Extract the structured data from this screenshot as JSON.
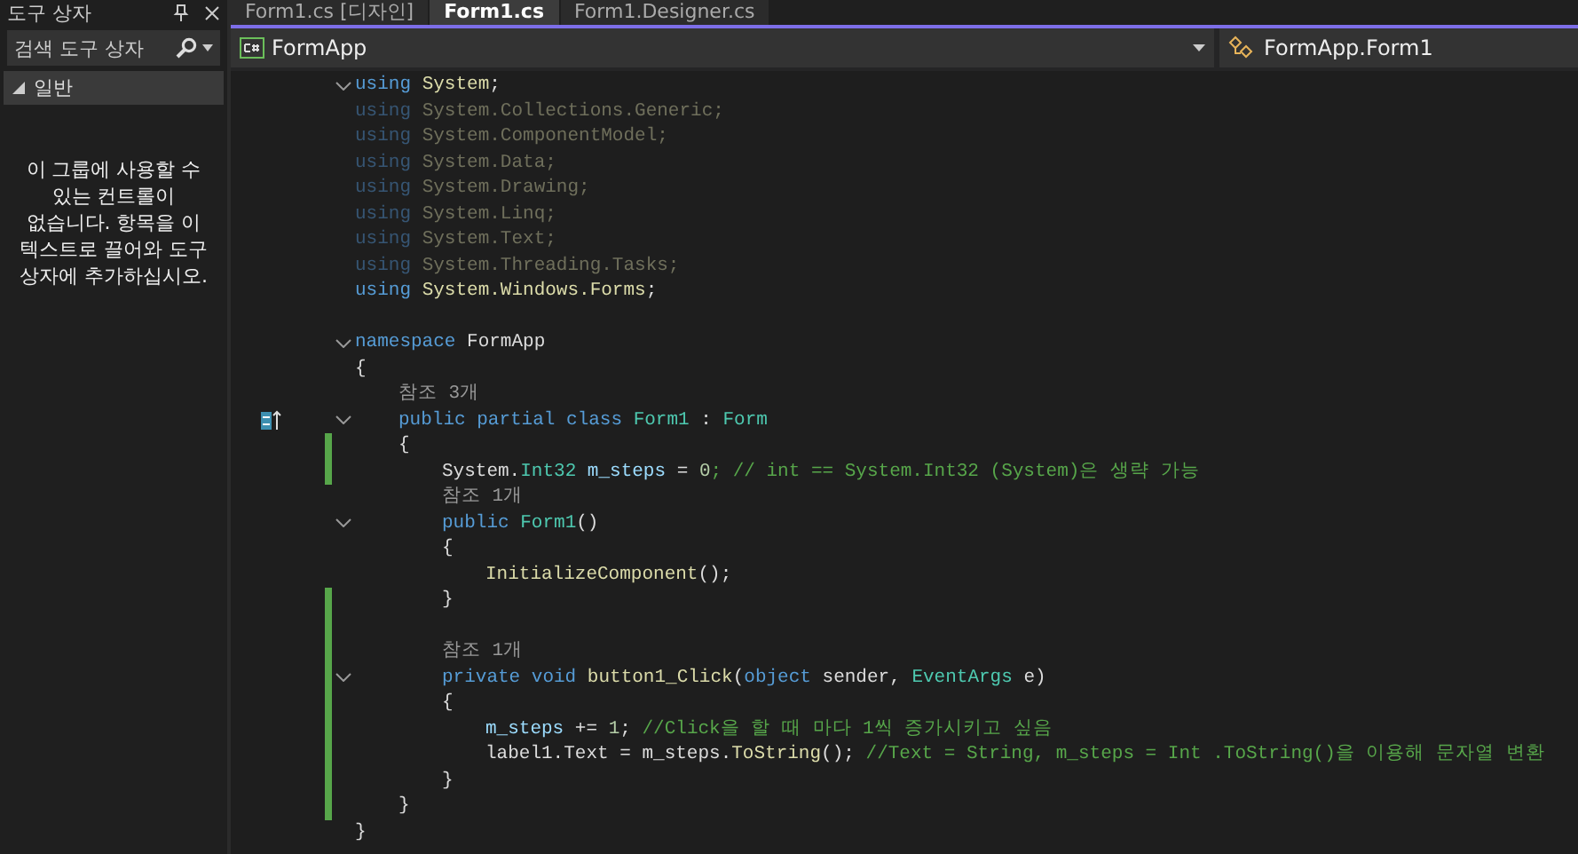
{
  "toolbox": {
    "title": "도구 상자",
    "search": {
      "placeholder": "검색 도구 상자"
    },
    "group": {
      "label": "일반",
      "expanded": true
    },
    "message": "이 그룹에 사용할 수 있는 컨트롤이 없습니다. 항목을 이 텍스트로 끌어와 도구 상자에 추가하십시오."
  },
  "tabs": [
    {
      "label": "Form1.cs [디자인]",
      "selected": false
    },
    {
      "label": "Form1.cs",
      "selected": true
    },
    {
      "label": "Form1.Designer.cs",
      "selected": false
    }
  ],
  "nav": {
    "project": "FormApp",
    "member": "FormApp.Form1"
  },
  "lines": [
    {
      "fold": true,
      "changed": false,
      "faded": false,
      "tokens": [
        {
          "text": "using ",
          "kind": "kw"
        },
        {
          "text": "System",
          "kind": "ns"
        },
        {
          "text": ";",
          "kind": "plain"
        }
      ]
    },
    {
      "fold": false,
      "changed": false,
      "faded": true,
      "tokens": [
        {
          "text": "using ",
          "kind": "kw"
        },
        {
          "text": "System.Collections.Generic;",
          "kind": "ns"
        }
      ]
    },
    {
      "fold": false,
      "changed": false,
      "faded": true,
      "tokens": [
        {
          "text": "using ",
          "kind": "kw"
        },
        {
          "text": "System.ComponentModel;",
          "kind": "ns"
        }
      ]
    },
    {
      "fold": false,
      "changed": false,
      "faded": true,
      "tokens": [
        {
          "text": "using ",
          "kind": "kw"
        },
        {
          "text": "System.Data;",
          "kind": "ns"
        }
      ]
    },
    {
      "fold": false,
      "changed": false,
      "faded": true,
      "tokens": [
        {
          "text": "using ",
          "kind": "kw"
        },
        {
          "text": "System.Drawing;",
          "kind": "ns"
        }
      ]
    },
    {
      "fold": false,
      "changed": false,
      "faded": true,
      "tokens": [
        {
          "text": "using ",
          "kind": "kw"
        },
        {
          "text": "System.Linq;",
          "kind": "ns"
        }
      ]
    },
    {
      "fold": false,
      "changed": false,
      "faded": true,
      "tokens": [
        {
          "text": "using ",
          "kind": "kw"
        },
        {
          "text": "System.Text;",
          "kind": "ns"
        }
      ]
    },
    {
      "fold": false,
      "changed": false,
      "faded": true,
      "tokens": [
        {
          "text": "using ",
          "kind": "kw"
        },
        {
          "text": "System.Threading.Tasks;",
          "kind": "ns"
        }
      ]
    },
    {
      "fold": false,
      "changed": false,
      "faded": false,
      "tokens": [
        {
          "text": "using ",
          "kind": "kw"
        },
        {
          "text": "System.Windows.Forms",
          "kind": "ns"
        },
        {
          "text": ";",
          "kind": "plain"
        }
      ]
    },
    {
      "fold": false,
      "changed": false
    },
    {
      "fold": true,
      "changed": false,
      "faded": false,
      "tokens": [
        {
          "text": "namespace ",
          "kind": "kw"
        },
        {
          "text": "FormApp",
          "kind": "plain"
        }
      ]
    },
    {
      "fold": false,
      "changed": false,
      "faded": false,
      "tokens": [
        {
          "text": "{",
          "kind": "plain"
        }
      ]
    },
    {
      "fold": false,
      "changed": false,
      "faded": false,
      "tokens": [
        {
          "text": "참조 3개",
          "kind": "lens"
        }
      ]
    },
    {
      "fold": true,
      "changed": false,
      "faded": false,
      "marker": true,
      "tokens": [
        {
          "text": "public partial class ",
          "kind": "kw"
        },
        {
          "text": "Form1",
          "kind": "type"
        },
        {
          "text": " : ",
          "kind": "plain"
        },
        {
          "text": "Form",
          "kind": "type"
        }
      ]
    },
    {
      "fold": false,
      "changed": true,
      "faded": false,
      "tokens": [
        {
          "text": "{",
          "kind": "plain"
        }
      ]
    },
    {
      "fold": false,
      "changed": true,
      "faded": false,
      "tokens": [
        {
          "text": "System.",
          "kind": "plain"
        },
        {
          "text": "Int32 ",
          "kind": "type"
        },
        {
          "text": "m_steps",
          "kind": "field"
        },
        {
          "text": " = ",
          "kind": "plain"
        },
        {
          "text": "0",
          "kind": "num"
        },
        {
          "text": "; // int == System.Int32 (System)은 생략 가능",
          "kind": "comment"
        }
      ]
    },
    {
      "fold": false,
      "changed": false,
      "faded": false,
      "tokens": [
        {
          "text": "참조 1개",
          "kind": "lens"
        }
      ]
    },
    {
      "fold": true,
      "changed": false,
      "faded": false,
      "tokens": [
        {
          "text": "public ",
          "kind": "kw"
        },
        {
          "text": "Form1",
          "kind": "type"
        },
        {
          "text": "()",
          "kind": "plain"
        }
      ]
    },
    {
      "fold": false,
      "changed": false,
      "faded": false,
      "tokens": [
        {
          "text": "{",
          "kind": "plain"
        }
      ]
    },
    {
      "fold": false,
      "changed": false,
      "faded": false,
      "tokens": [
        {
          "text": "InitializeComponent",
          "kind": "method"
        },
        {
          "text": "();",
          "kind": "plain"
        }
      ]
    },
    {
      "fold": false,
      "changed": true,
      "faded": false,
      "tokens": [
        {
          "text": "}",
          "kind": "plain"
        }
      ]
    },
    {
      "fold": false,
      "changed": true
    },
    {
      "fold": false,
      "changed": true,
      "faded": false,
      "tokens": [
        {
          "text": "참조 1개",
          "kind": "lens"
        }
      ]
    },
    {
      "fold": true,
      "changed": true,
      "faded": false,
      "tokens": [
        {
          "text": "private void ",
          "kind": "kw"
        },
        {
          "text": "button1_Click",
          "kind": "method"
        },
        {
          "text": "(",
          "kind": "plain"
        },
        {
          "text": "object ",
          "kind": "kw"
        },
        {
          "text": "sender, ",
          "kind": "plain"
        },
        {
          "text": "EventArgs ",
          "kind": "type"
        },
        {
          "text": "e)",
          "kind": "plain"
        }
      ]
    },
    {
      "fold": false,
      "changed": true,
      "faded": false,
      "tokens": [
        {
          "text": "{",
          "kind": "plain"
        }
      ]
    },
    {
      "fold": false,
      "changed": true,
      "faded": false,
      "tokens": [
        {
          "text": "m_steps",
          "kind": "field"
        },
        {
          "text": " += ",
          "kind": "plain"
        },
        {
          "text": "1",
          "kind": "num"
        },
        {
          "text": "; ",
          "kind": "plain"
        },
        {
          "text": "//Click을 할 때 마다 1씩 증가시키고 싶음",
          "kind": "comment"
        }
      ]
    },
    {
      "fold": false,
      "changed": true,
      "faded": false,
      "tokens": [
        {
          "text": "label1.Text = m_steps.",
          "kind": "plain"
        },
        {
          "text": "ToString",
          "kind": "method"
        },
        {
          "text": "(); ",
          "kind": "plain"
        },
        {
          "text": "//Text = String, m_steps = Int .ToString()을 이용해 문자열 변환",
          "kind": "comment"
        }
      ]
    },
    {
      "fold": false,
      "changed": true,
      "faded": false,
      "tokens": [
        {
          "text": "}",
          "kind": "plain"
        }
      ]
    },
    {
      "fold": false,
      "changed": true,
      "faded": false,
      "tokens": [
        {
          "text": "}",
          "kind": "plain"
        }
      ]
    },
    {
      "fold": false,
      "changed": false,
      "faded": false,
      "tokens": [
        {
          "text": "}",
          "kind": "plain"
        }
      ]
    }
  ]
}
